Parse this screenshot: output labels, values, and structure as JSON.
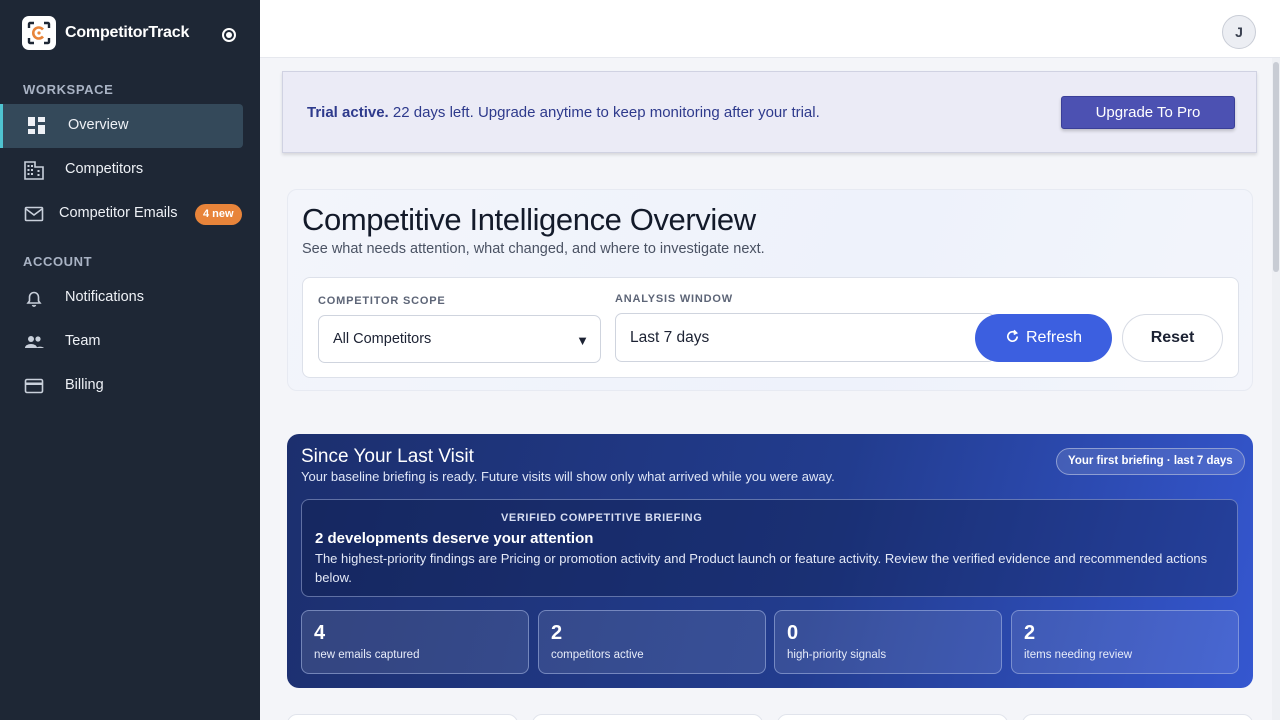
{
  "brand": {
    "name": "CompetitorTrack",
    "accent": "#e8843a"
  },
  "sidebar": {
    "sections": [
      {
        "title": "WORKSPACE"
      },
      {
        "title": "ACCOUNT"
      }
    ],
    "items": [
      {
        "label": "Overview",
        "icon": "dashboard-icon",
        "active": true
      },
      {
        "label": "Competitors",
        "icon": "building-icon"
      },
      {
        "label": "Competitor Emails",
        "icon": "mail-icon",
        "badge": "4 new"
      },
      {
        "label": "Notifications",
        "icon": "bell-icon"
      },
      {
        "label": "Team",
        "icon": "people-icon"
      },
      {
        "label": "Billing",
        "icon": "credit-card-icon"
      }
    ]
  },
  "topbar": {
    "avatar_initial": "J"
  },
  "trial": {
    "status": "Trial active.",
    "message": "22 days left. Upgrade anytime to keep monitoring after your trial.",
    "upgrade_label": "Upgrade To Pro"
  },
  "overview": {
    "title": "Competitive Intelligence Overview",
    "subtitle": "See what needs attention, what changed, and where to investigate next.",
    "scope_label": "COMPETITOR SCOPE",
    "scope_value": "All Competitors",
    "window_label": "ANALYSIS WINDOW",
    "window_value": "Last 7 days",
    "refresh_label": "Refresh",
    "reset_label": "Reset"
  },
  "visit": {
    "title": "Since Your Last Visit",
    "subtitle": "Your baseline briefing is ready. Future visits will show only what arrived while you were away.",
    "pill": "Your first briefing · last 7 days",
    "briefing_label": "VERIFIED COMPETITIVE BRIEFING",
    "briefing_head": "2 developments deserve your attention",
    "briefing_body": "The highest-priority findings are Pricing or promotion activity and Product launch or feature activity. Review the verified evidence and recommended actions below.",
    "stats": [
      {
        "value": "4",
        "caption": "new emails captured"
      },
      {
        "value": "2",
        "caption": "competitors active"
      },
      {
        "value": "0",
        "caption": "high-priority signals"
      },
      {
        "value": "2",
        "caption": "items needing review"
      }
    ]
  }
}
